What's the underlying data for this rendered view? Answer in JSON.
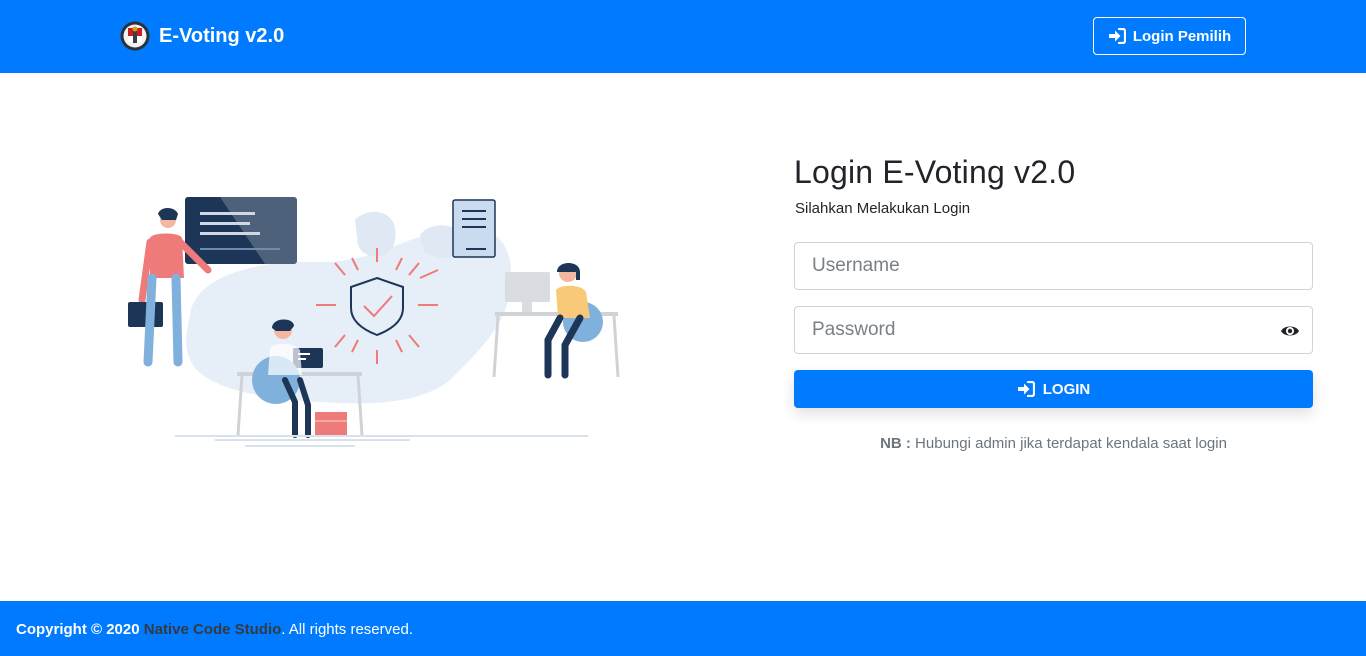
{
  "navbar": {
    "brand_title": "E-Voting v2.0",
    "login_pemilih_label": "Login Pemilih",
    "brand_color": "#007bff"
  },
  "login": {
    "title": "Login E-Voting v2.0",
    "subtitle": "Silahkan Melakukan Login",
    "username_placeholder": "Username",
    "password_placeholder": "Password",
    "submit_label": "LOGIN",
    "note_label": "NB :",
    "note_text": " Hubungi admin jika terdapat kendala saat login"
  },
  "icons": {
    "login_pemilih": "sign-in-icon",
    "login_submit": "sign-in-icon",
    "password_toggle": "eye-icon",
    "brand": "kpu-logo-icon"
  },
  "footer": {
    "copyright": "Copyright © 2020",
    "studio": "Native Code Studio",
    "rights": ". All rights reserved."
  }
}
